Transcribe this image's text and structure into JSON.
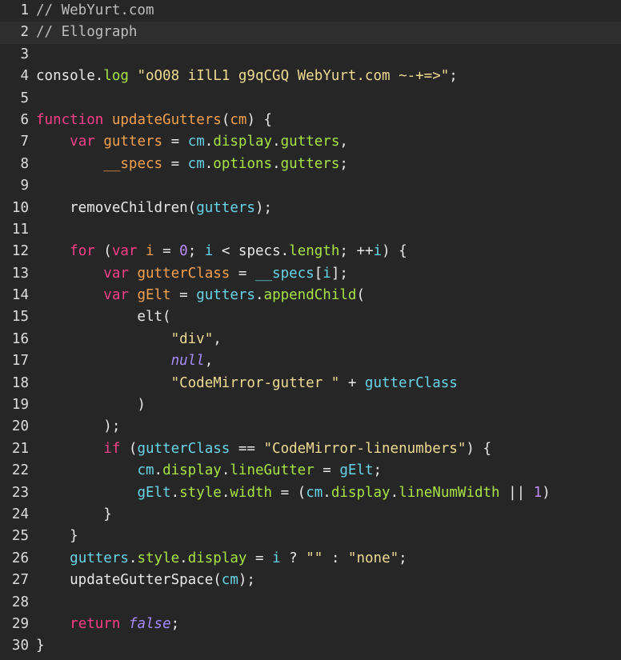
{
  "editor": {
    "lines": [
      {
        "n": "1",
        "t": [
          {
            "c": "cm",
            "v": "// WebYurt.com"
          }
        ]
      },
      {
        "n": "2",
        "active": true,
        "t": [
          {
            "c": "cm",
            "v": "// Ellograph"
          }
        ]
      },
      {
        "n": "3",
        "t": []
      },
      {
        "n": "4",
        "t": [
          {
            "c": "pl",
            "v": "console."
          },
          {
            "c": "prop",
            "v": "log"
          },
          {
            "c": "pl",
            "v": " "
          },
          {
            "c": "str",
            "v": "\"oO08 iIlL1 g9qCGQ WebYurt.com ~-+=>\""
          },
          {
            "c": "pl",
            "v": ";"
          }
        ]
      },
      {
        "n": "5",
        "t": []
      },
      {
        "n": "6",
        "t": [
          {
            "c": "kw",
            "v": "function"
          },
          {
            "c": "pl",
            "v": " "
          },
          {
            "c": "fn",
            "v": "updateGutters"
          },
          {
            "c": "pl",
            "v": "("
          },
          {
            "c": "fn",
            "v": "cm"
          },
          {
            "c": "pl",
            "v": ") {"
          }
        ]
      },
      {
        "n": "7",
        "t": [
          {
            "c": "pl",
            "v": "    "
          },
          {
            "c": "kw",
            "v": "var"
          },
          {
            "c": "pl",
            "v": " "
          },
          {
            "c": "fn",
            "v": "gutters"
          },
          {
            "c": "pl",
            "v": " = "
          },
          {
            "c": "var",
            "v": "cm"
          },
          {
            "c": "pl",
            "v": "."
          },
          {
            "c": "prop",
            "v": "display"
          },
          {
            "c": "pl",
            "v": "."
          },
          {
            "c": "prop",
            "v": "gutters"
          },
          {
            "c": "pl",
            "v": ","
          }
        ]
      },
      {
        "n": "8",
        "t": [
          {
            "c": "pl",
            "v": "        "
          },
          {
            "c": "fn",
            "v": "__specs"
          },
          {
            "c": "pl",
            "v": " = "
          },
          {
            "c": "var",
            "v": "cm"
          },
          {
            "c": "pl",
            "v": "."
          },
          {
            "c": "prop",
            "v": "options"
          },
          {
            "c": "pl",
            "v": "."
          },
          {
            "c": "prop",
            "v": "gutters"
          },
          {
            "c": "pl",
            "v": ";"
          }
        ]
      },
      {
        "n": "9",
        "t": []
      },
      {
        "n": "10",
        "t": [
          {
            "c": "pl",
            "v": "    removeChildren("
          },
          {
            "c": "var",
            "v": "gutters"
          },
          {
            "c": "pl",
            "v": ");"
          }
        ]
      },
      {
        "n": "11",
        "t": []
      },
      {
        "n": "12",
        "t": [
          {
            "c": "pl",
            "v": "    "
          },
          {
            "c": "kw",
            "v": "for"
          },
          {
            "c": "pl",
            "v": " ("
          },
          {
            "c": "kw",
            "v": "var"
          },
          {
            "c": "pl",
            "v": " "
          },
          {
            "c": "fn",
            "v": "i"
          },
          {
            "c": "pl",
            "v": " = "
          },
          {
            "c": "num",
            "v": "0"
          },
          {
            "c": "pl",
            "v": "; "
          },
          {
            "c": "var",
            "v": "i"
          },
          {
            "c": "pl",
            "v": " < specs."
          },
          {
            "c": "prop",
            "v": "length"
          },
          {
            "c": "pl",
            "v": "; ++"
          },
          {
            "c": "var",
            "v": "i"
          },
          {
            "c": "pl",
            "v": ") {"
          }
        ]
      },
      {
        "n": "13",
        "t": [
          {
            "c": "pl",
            "v": "        "
          },
          {
            "c": "kw",
            "v": "var"
          },
          {
            "c": "pl",
            "v": " "
          },
          {
            "c": "fn",
            "v": "gutterClass"
          },
          {
            "c": "pl",
            "v": " = "
          },
          {
            "c": "var",
            "v": "__specs"
          },
          {
            "c": "pl",
            "v": "["
          },
          {
            "c": "var",
            "v": "i"
          },
          {
            "c": "pl",
            "v": "];"
          }
        ]
      },
      {
        "n": "14",
        "t": [
          {
            "c": "pl",
            "v": "        "
          },
          {
            "c": "kw",
            "v": "var"
          },
          {
            "c": "pl",
            "v": " "
          },
          {
            "c": "fn",
            "v": "gElt"
          },
          {
            "c": "pl",
            "v": " = "
          },
          {
            "c": "var",
            "v": "gutters"
          },
          {
            "c": "pl",
            "v": "."
          },
          {
            "c": "prop",
            "v": "appendChild"
          },
          {
            "c": "pl",
            "v": "("
          }
        ]
      },
      {
        "n": "15",
        "t": [
          {
            "c": "pl",
            "v": "            elt("
          }
        ]
      },
      {
        "n": "16",
        "t": [
          {
            "c": "pl",
            "v": "                "
          },
          {
            "c": "str",
            "v": "\"div\""
          },
          {
            "c": "pl",
            "v": ","
          }
        ]
      },
      {
        "n": "17",
        "t": [
          {
            "c": "pl",
            "v": "                "
          },
          {
            "c": "lit",
            "v": "null"
          },
          {
            "c": "pl",
            "v": ","
          }
        ]
      },
      {
        "n": "18",
        "t": [
          {
            "c": "pl",
            "v": "                "
          },
          {
            "c": "str",
            "v": "\"CodeMirror-gutter \""
          },
          {
            "c": "pl",
            "v": " + "
          },
          {
            "c": "var",
            "v": "gutterClass"
          }
        ]
      },
      {
        "n": "19",
        "t": [
          {
            "c": "pl",
            "v": "            )"
          }
        ]
      },
      {
        "n": "20",
        "t": [
          {
            "c": "pl",
            "v": "        );"
          }
        ]
      },
      {
        "n": "21",
        "t": [
          {
            "c": "pl",
            "v": "        "
          },
          {
            "c": "kw",
            "v": "if"
          },
          {
            "c": "pl",
            "v": " ("
          },
          {
            "c": "var",
            "v": "gutterClass"
          },
          {
            "c": "pl",
            "v": " == "
          },
          {
            "c": "str",
            "v": "\"CodeMirror-linenumbers\""
          },
          {
            "c": "pl",
            "v": ") {"
          }
        ]
      },
      {
        "n": "22",
        "t": [
          {
            "c": "pl",
            "v": "            "
          },
          {
            "c": "var",
            "v": "cm"
          },
          {
            "c": "pl",
            "v": "."
          },
          {
            "c": "prop",
            "v": "display"
          },
          {
            "c": "pl",
            "v": "."
          },
          {
            "c": "prop",
            "v": "lineGutter"
          },
          {
            "c": "pl",
            "v": " = "
          },
          {
            "c": "var",
            "v": "gElt"
          },
          {
            "c": "pl",
            "v": ";"
          }
        ]
      },
      {
        "n": "23",
        "t": [
          {
            "c": "pl",
            "v": "            "
          },
          {
            "c": "var",
            "v": "gElt"
          },
          {
            "c": "pl",
            "v": "."
          },
          {
            "c": "prop",
            "v": "style"
          },
          {
            "c": "pl",
            "v": "."
          },
          {
            "c": "prop",
            "v": "width"
          },
          {
            "c": "pl",
            "v": " = ("
          },
          {
            "c": "var",
            "v": "cm"
          },
          {
            "c": "pl",
            "v": "."
          },
          {
            "c": "prop",
            "v": "display"
          },
          {
            "c": "pl",
            "v": "."
          },
          {
            "c": "prop",
            "v": "lineNumWidth"
          },
          {
            "c": "pl",
            "v": " || "
          },
          {
            "c": "num",
            "v": "1"
          },
          {
            "c": "pl",
            "v": ")"
          }
        ]
      },
      {
        "n": "24",
        "t": [
          {
            "c": "pl",
            "v": "        }"
          }
        ]
      },
      {
        "n": "25",
        "t": [
          {
            "c": "pl",
            "v": "    }"
          }
        ]
      },
      {
        "n": "26",
        "t": [
          {
            "c": "pl",
            "v": "    "
          },
          {
            "c": "var",
            "v": "gutters"
          },
          {
            "c": "pl",
            "v": "."
          },
          {
            "c": "prop",
            "v": "style"
          },
          {
            "c": "pl",
            "v": "."
          },
          {
            "c": "prop",
            "v": "display"
          },
          {
            "c": "pl",
            "v": " = "
          },
          {
            "c": "var",
            "v": "i"
          },
          {
            "c": "pl",
            "v": " ? "
          },
          {
            "c": "str",
            "v": "\"\""
          },
          {
            "c": "pl",
            "v": " : "
          },
          {
            "c": "str",
            "v": "\"none\""
          },
          {
            "c": "pl",
            "v": ";"
          }
        ]
      },
      {
        "n": "27",
        "t": [
          {
            "c": "pl",
            "v": "    updateGutterSpace("
          },
          {
            "c": "var",
            "v": "cm"
          },
          {
            "c": "pl",
            "v": ");"
          }
        ]
      },
      {
        "n": "28",
        "t": []
      },
      {
        "n": "29",
        "t": [
          {
            "c": "pl",
            "v": "    "
          },
          {
            "c": "kw",
            "v": "return"
          },
          {
            "c": "pl",
            "v": " "
          },
          {
            "c": "lit",
            "v": "false"
          },
          {
            "c": "pl",
            "v": ";"
          }
        ]
      },
      {
        "n": "30",
        "t": [
          {
            "c": "pl",
            "v": "}"
          }
        ]
      }
    ]
  }
}
